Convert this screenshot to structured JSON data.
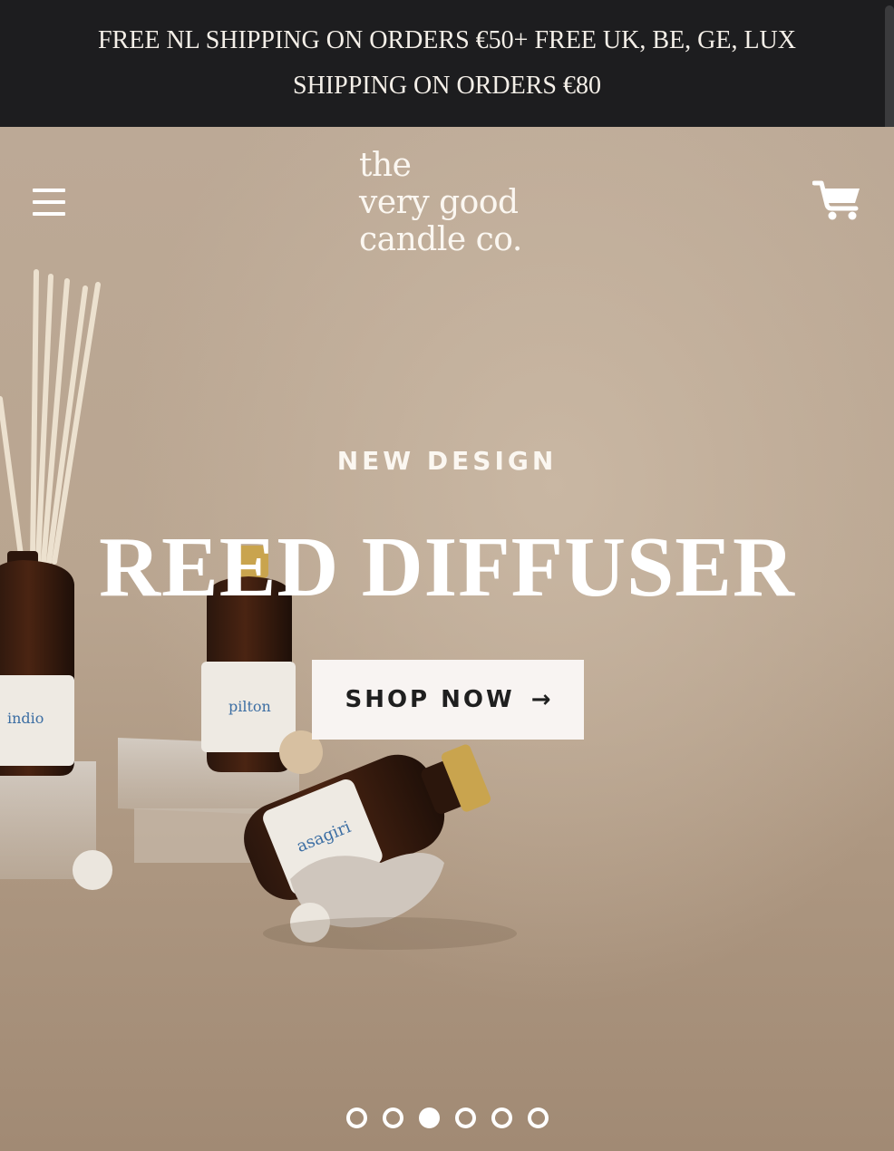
{
  "announcement": {
    "text": "FREE NL SHIPPING ON ORDERS €50+ FREE UK, BE, GE, LUX SHIPPING ON ORDERS €80"
  },
  "header": {
    "logo_lines": [
      "the",
      "very good",
      "candle co."
    ],
    "menu_icon": "hamburger-menu-icon",
    "cart_icon": "cart-icon"
  },
  "hero": {
    "eyebrow": "NEW DESIGN",
    "title": "REED DIFFUSER",
    "cta_label": "SHOP NOW",
    "cta_arrow": "→",
    "bottle_labels": [
      "indio",
      "pilton",
      "asagiri"
    ],
    "slides": {
      "count": 6,
      "active_index": 2
    }
  },
  "colors": {
    "announcement_bg": "#1d1d1f",
    "hero_bg": "#b9a590",
    "cta_bg": "#f8f4f2",
    "text_light": "#ffffff"
  }
}
